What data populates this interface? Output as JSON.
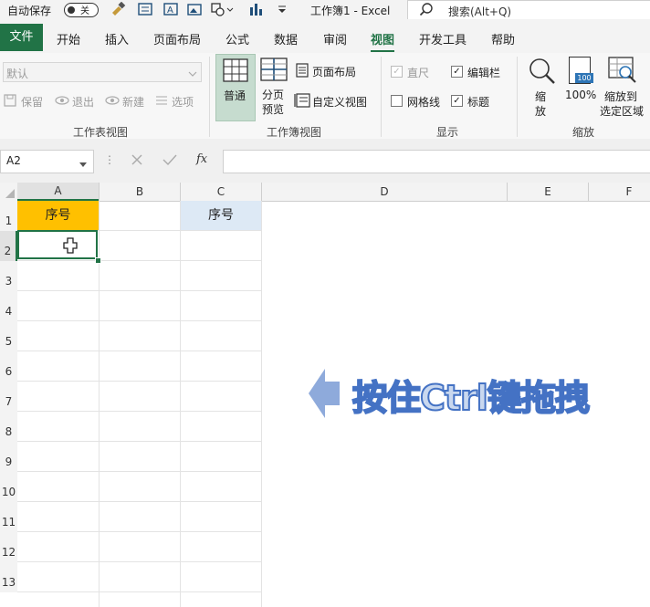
{
  "titlebar": {
    "autosave_label": "自动保存",
    "toggle_state": "关",
    "doc_title": "工作簿1  -  Excel",
    "search_placeholder": "搜索(Alt+Q)"
  },
  "tabs": [
    "文件",
    "开始",
    "插入",
    "页面布局",
    "公式",
    "数据",
    "审阅",
    "视图",
    "开发工具",
    "帮助"
  ],
  "active_tab": "视图",
  "ribbon": {
    "sheet_view": {
      "dropdown_value": "默认",
      "keep": "保留",
      "exit": "退出",
      "new": "新建",
      "options": "选项",
      "label": "工作表视图"
    },
    "workbook_view": {
      "normal": "普通",
      "page_break_1": "分页",
      "page_break_2": "预览",
      "page_layout": "页面布局",
      "custom_view": "自定义视图",
      "label": "工作簿视图"
    },
    "show": {
      "ruler": "直尺",
      "formula_bar": "编辑栏",
      "gridlines": "网格线",
      "headings": "标题",
      "label": "显示"
    },
    "zoom": {
      "zoom_1": "缩",
      "zoom_2": "放",
      "percent": "100%",
      "icon_badge": "100",
      "fit_1": "缩放到",
      "fit_2": "选定区域",
      "label": "缩放"
    }
  },
  "formula_bar": {
    "name_box": "A2",
    "fx": "fx",
    "formula": ""
  },
  "columns": [
    "A",
    "B",
    "C",
    "D",
    "E",
    "F"
  ],
  "rows": [
    "1",
    "2",
    "3",
    "4",
    "5",
    "6",
    "7",
    "8",
    "9",
    "10",
    "11",
    "12",
    "13"
  ],
  "cells": {
    "A1": "序号",
    "C1": "序号"
  },
  "annotation": {
    "text": "按住Ctrl键拖拽"
  },
  "colors": {
    "excel_green": "#217346",
    "header_orange": "#ffc000",
    "header_blue": "#dde9f5",
    "arrow_blue": "#8eaadb",
    "annotation_blue": "#4472c4"
  }
}
